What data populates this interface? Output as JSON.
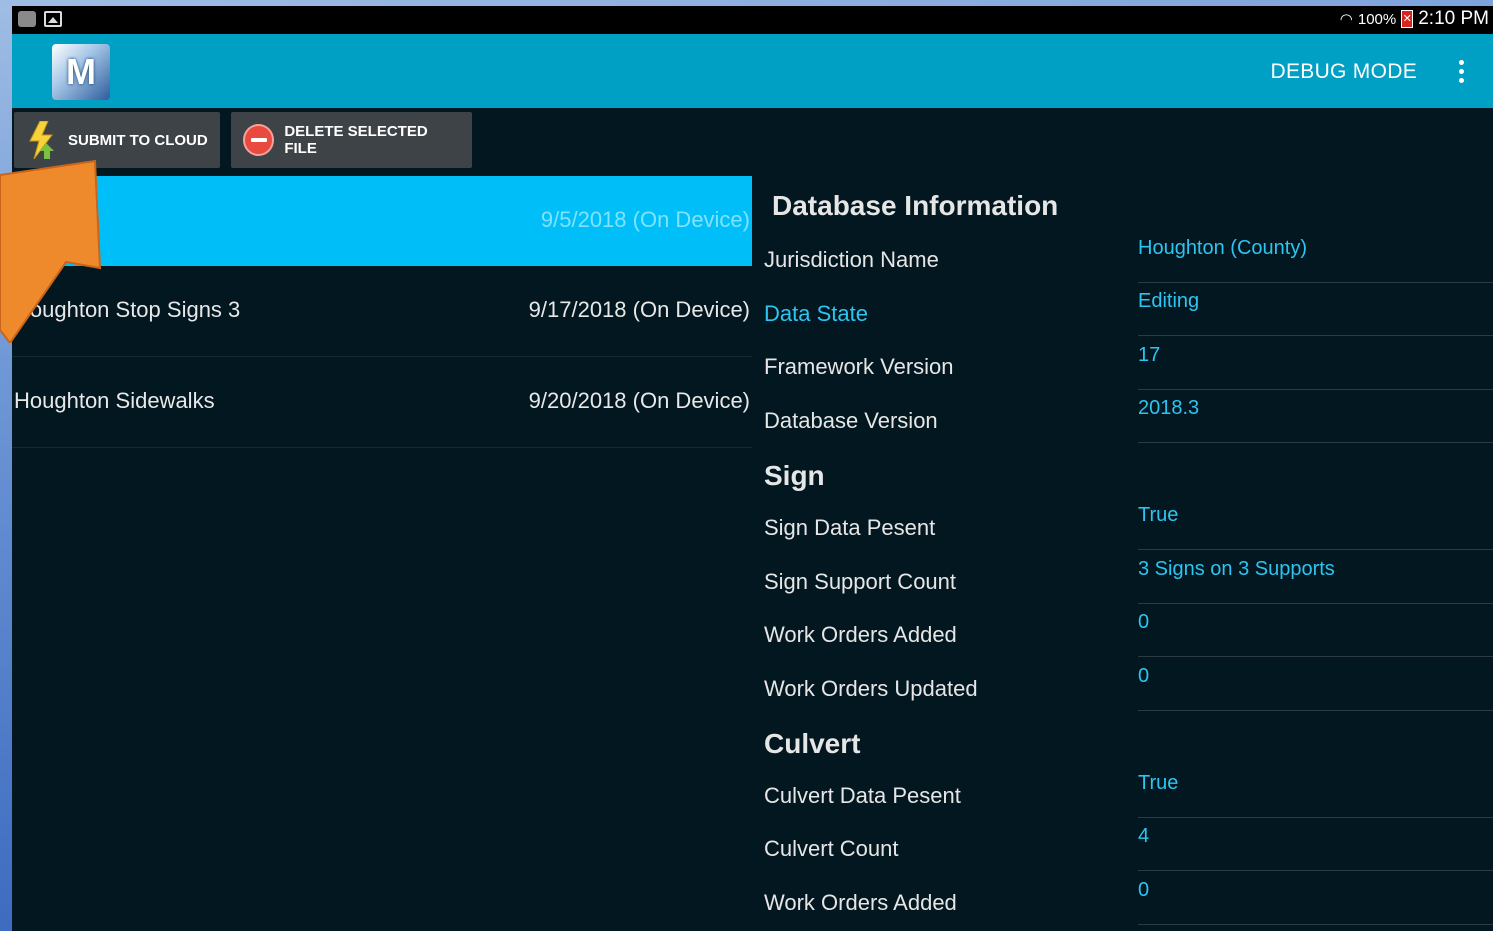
{
  "status_bar": {
    "battery_percent": "100%",
    "time": "2:10 PM"
  },
  "action_bar": {
    "logo_letter": "M",
    "debug_mode_label": "DEBUG MODE"
  },
  "toolbar": {
    "submit_label": "SUBMIT TO CLOUD",
    "delete_label": "DELETE SELECTED FILE"
  },
  "files": [
    {
      "name": "",
      "date": "9/5/2018 (On Device)",
      "selected": true
    },
    {
      "name": "Houghton Stop Signs 3",
      "date": "9/17/2018 (On Device)",
      "selected": false
    },
    {
      "name": "Houghton Sidewalks",
      "date": "9/20/2018 (On Device)",
      "selected": false
    }
  ],
  "database_info": {
    "heading": "Database Information",
    "rows": [
      {
        "label": "Jurisdiction Name",
        "value": "Houghton (County)"
      },
      {
        "label": "Data State",
        "value": "Editing"
      },
      {
        "label": "Framework Version",
        "value": "17"
      },
      {
        "label": "Database Version",
        "value": "2018.3"
      }
    ]
  },
  "sign": {
    "heading": "Sign",
    "rows": [
      {
        "label": "Sign Data Pesent",
        "value": "True"
      },
      {
        "label": "Sign Support Count",
        "value": "3 Signs on 3 Supports"
      },
      {
        "label": "Work Orders Added",
        "value": "0"
      },
      {
        "label": "Work Orders Updated",
        "value": "0"
      }
    ]
  },
  "culvert": {
    "heading": "Culvert",
    "rows": [
      {
        "label": "Culvert Data Pesent",
        "value": "True"
      },
      {
        "label": "Culvert Count",
        "value": "4"
      },
      {
        "label": "Work Orders Added",
        "value": "0"
      }
    ]
  },
  "colors": {
    "action_bar": "#00a0c5",
    "selected_row": "#00bff8",
    "value_text": "#2cc5f2",
    "screen_bg": "#02171f",
    "annotation_arrow": "#ef8a2c"
  }
}
